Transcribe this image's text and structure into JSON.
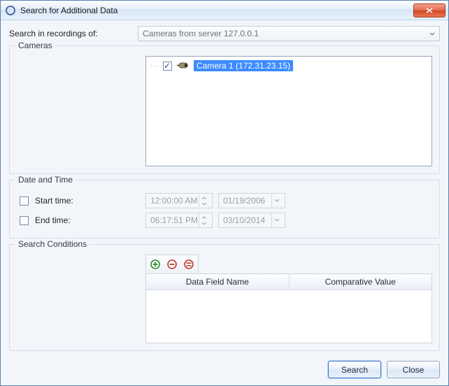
{
  "window": {
    "title": "Search for Additional Data"
  },
  "searchIn": {
    "label": "Search in recordings of:",
    "selected": "Cameras from server 127.0.0.1"
  },
  "cameras": {
    "legend": "Cameras",
    "items": [
      {
        "checked": true,
        "label": "Camera 1 (172.31.23.15)"
      }
    ]
  },
  "dateTime": {
    "legend": "Date and Time",
    "start": {
      "enabled": false,
      "label": "Start time:",
      "time": "12:00:00 AM",
      "date": "01/19/2006"
    },
    "end": {
      "enabled": false,
      "label": "End time:",
      "time": "06:17:51 PM",
      "date": "03/10/2014"
    }
  },
  "conditions": {
    "legend": "Search Conditions",
    "columns": {
      "field": "Data Field Name",
      "value": "Comparative Value"
    },
    "rows": []
  },
  "buttons": {
    "search": "Search",
    "close": "Close"
  },
  "icons": {
    "app": "lens-icon",
    "close": "close-icon",
    "chevron": "chevron-down-icon",
    "add": "add-icon",
    "remove": "remove-icon",
    "clear": "clear-all-icon",
    "camera": "camera-icon",
    "spinUp": "spin-up-icon",
    "spinDown": "spin-down-icon"
  }
}
